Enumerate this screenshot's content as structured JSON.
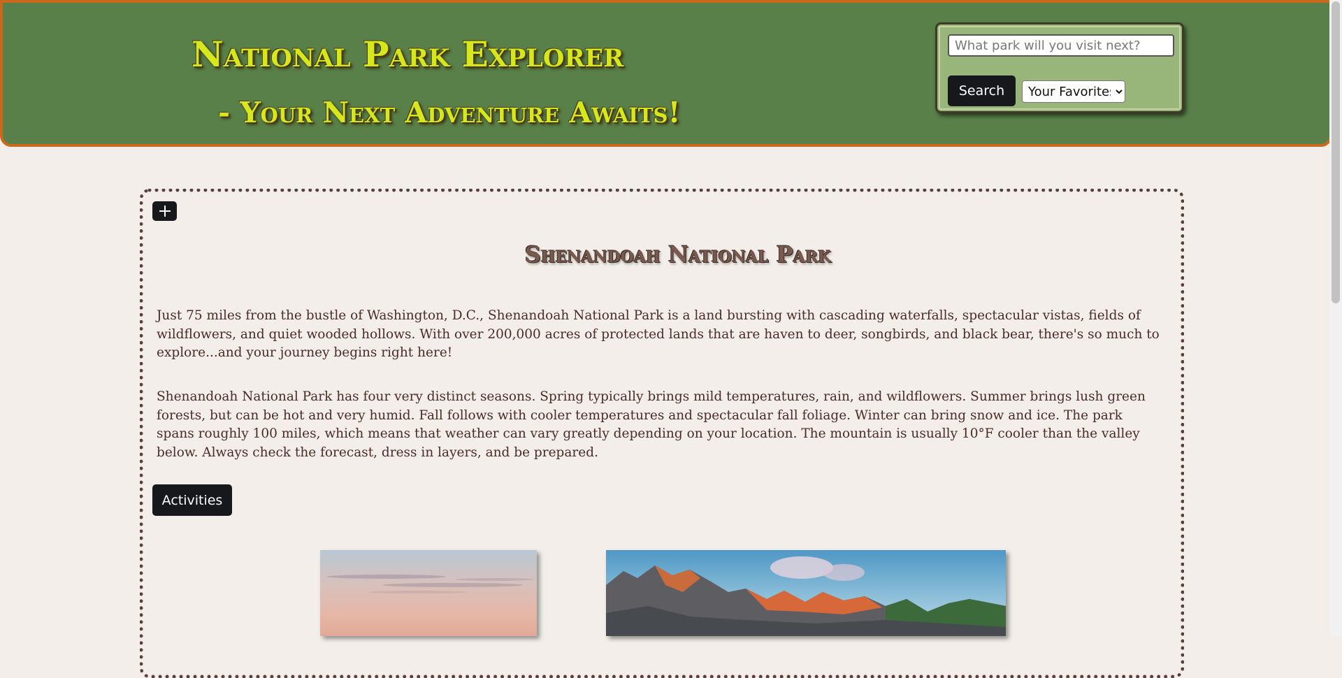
{
  "header": {
    "title": "National Park Explorer",
    "subtitle": "- Your Next Adventure Awaits!",
    "search": {
      "placeholder": "What park will you visit next?",
      "value": "",
      "button_label": "Search"
    },
    "favorites": {
      "selected": "Your Favorites",
      "options": [
        "Your Favorites"
      ]
    }
  },
  "park": {
    "add_icon": "plus-icon",
    "name": "Shenandoah National Park",
    "description_1": "Just 75 miles from the bustle of Washington, D.C., Shenandoah National Park is a land bursting with cascading waterfalls, spectacular vistas, fields of wildflowers, and quiet wooded hollows. With over 200,000 acres of protected lands that are haven to deer, songbirds, and black bear, there's so much to explore...and your journey begins right here!",
    "description_2": "Shenandoah National Park has four very distinct seasons. Spring typically brings mild temperatures, rain, and wildflowers. Summer brings lush green forests, but can be hot and very humid. Fall follows with cooler temperatures and spectacular fall foliage. Winter can bring snow and ice. The park spans roughly 100 miles, which means that weather can vary greatly depending on your location. The mountain is usually 10°F cooler than the valley below. Always check the forecast, dress in layers, and be prepared.",
    "activities_label": "Activities"
  },
  "colors": {
    "header_bg": "#5a8049",
    "header_border": "#c8691d",
    "title_text": "#d6e81c",
    "search_panel_bg": "#98b57a",
    "page_bg": "#f3eeea",
    "button_bg": "#17181c",
    "card_border": "#5a4038",
    "body_text": "#4a2c25"
  }
}
